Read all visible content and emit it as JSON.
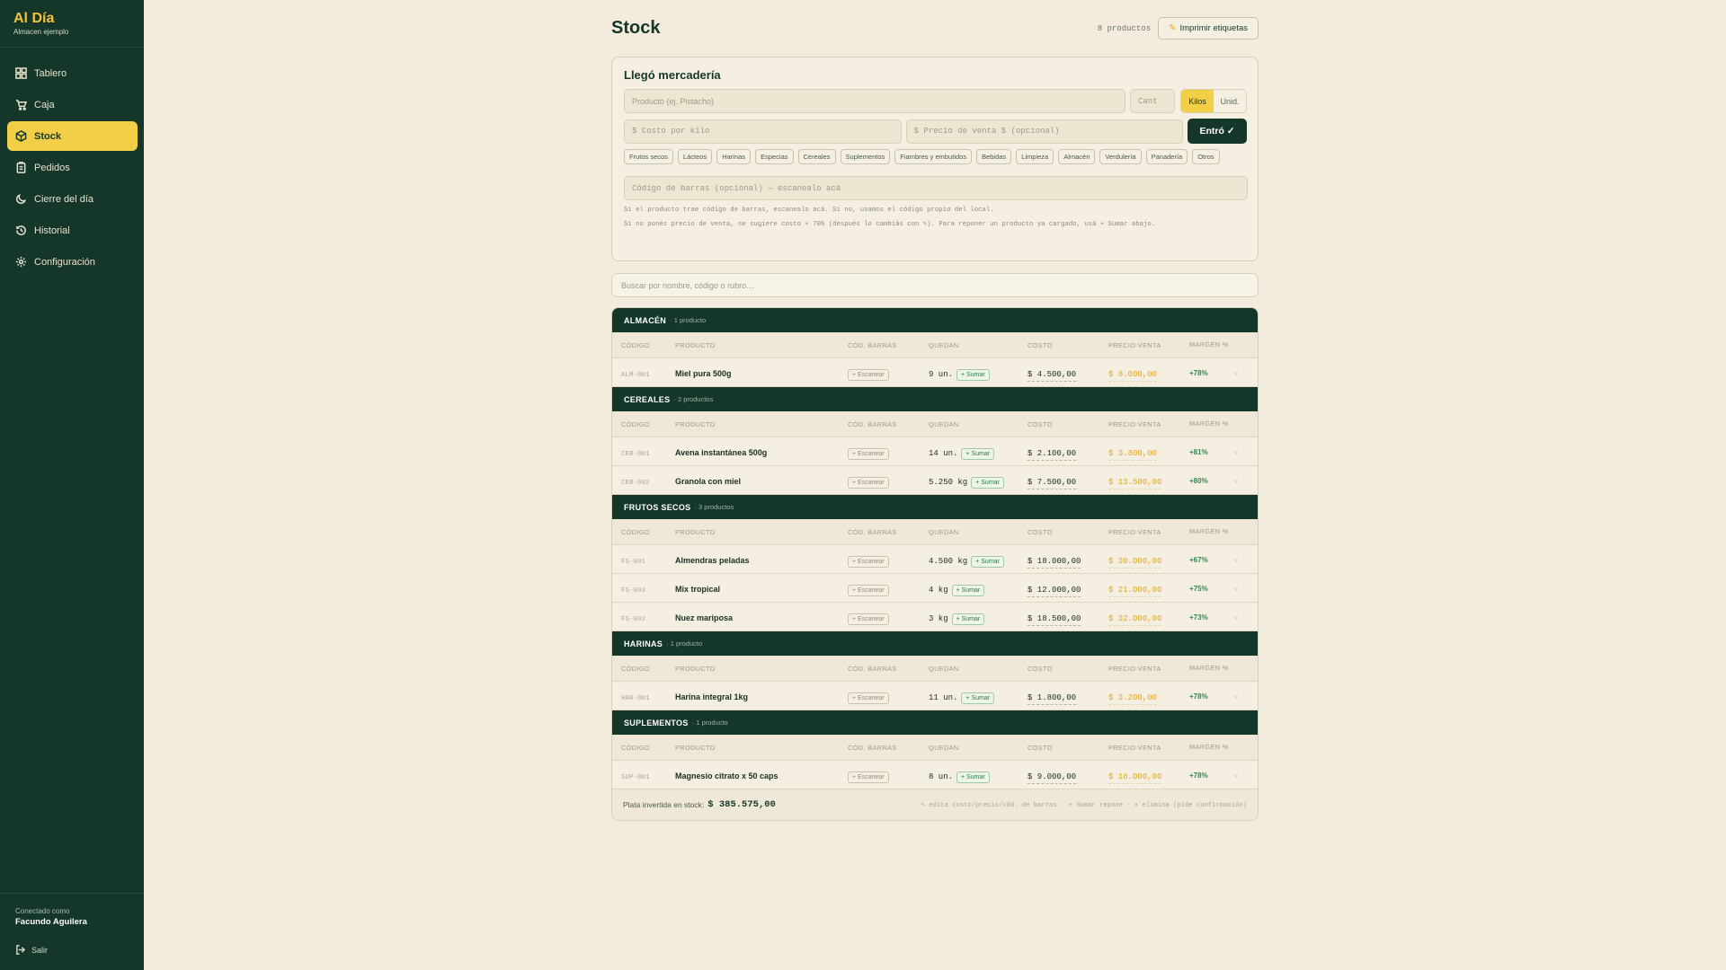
{
  "brand": {
    "name": "Al Día",
    "subtitle": "Almacen ejemplo"
  },
  "nav": [
    {
      "label": "Tablero",
      "icon": "grid-icon",
      "active": false
    },
    {
      "label": "Caja",
      "icon": "cart-icon",
      "active": false
    },
    {
      "label": "Stock",
      "icon": "box-icon",
      "active": true
    },
    {
      "label": "Pedidos",
      "icon": "clipboard-icon",
      "active": false
    },
    {
      "label": "Cierre del día",
      "icon": "moon-icon",
      "active": false
    },
    {
      "label": "Historial",
      "icon": "history-icon",
      "active": false
    },
    {
      "label": "Configuración",
      "icon": "gear-icon",
      "active": false
    }
  ],
  "user": {
    "caption": "Conectado como",
    "name": "Facundo Aguilera",
    "logout": "Salir"
  },
  "colors": {
    "sidebar": "#15372a",
    "accent": "#f3cf48",
    "background": "#f3ecdc",
    "price": "#e2a81b",
    "margin": "#2f8a4e"
  },
  "header": {
    "title": "Stock",
    "count": "8 productos",
    "print_label": "Imprimir etiquetas"
  },
  "form": {
    "title": "Llegó mercadería",
    "product_placeholder": "Producto (ej. Pistacho)",
    "qty_placeholder": "Cant",
    "unit_kilos": "Kilos",
    "unit_units": "Unid.",
    "cost_placeholder": "$ Costo por kilo",
    "price_placeholder": "$ Precio de venta $ (opcional)",
    "submit": "Entró ✓",
    "categories": [
      "Frutos secos",
      "Lácteos",
      "Harinas",
      "Especias",
      "Cereales",
      "Suplementos",
      "Fiambres y embutidos",
      "Bebidas",
      "Limpieza",
      "Almacén",
      "Verdulería",
      "Panadería",
      "Otros"
    ],
    "barcode_placeholder": "Código de barras (opcional) — escanealo acá",
    "help1": "Si el producto trae código de barras, escanealo acá. Si no, usamos el código propio del local.",
    "help2": "Si no ponés precio de venta, se sugiere costo + 70% (después lo cambiás con ✎). Para reponer un producto ya cargado, usá + Sumar abajo."
  },
  "search": {
    "placeholder": "Buscar por nombre, código o rubro…"
  },
  "table": {
    "columns": [
      "CÓDIGO",
      "PRODUCTO",
      "CÓD. BARRAS",
      "QUEDAN",
      "COSTO",
      "PRECIO VENTA",
      "MARGEN %"
    ],
    "scan_label": "+ Escanear",
    "add_label": "+ Sumar",
    "delete_glyph": "×",
    "groups": [
      {
        "name": "ALMACÉN",
        "count": "· 1 producto",
        "rows": [
          {
            "code": "ALM-001",
            "name": "Miel pura 500g",
            "qty": "9 un.",
            "cost": "$ 4.500,00",
            "price": "$ 8.000,00",
            "margin": "+78%"
          }
        ]
      },
      {
        "name": "CEREALES",
        "count": "· 2 productos",
        "rows": [
          {
            "code": "CER-001",
            "name": "Avena instantánea 500g",
            "qty": "14 un.",
            "cost": "$ 2.100,00",
            "price": "$ 3.800,00",
            "margin": "+81%"
          },
          {
            "code": "CER-002",
            "name": "Granola con miel",
            "qty": "5.250 kg",
            "cost": "$ 7.500,00",
            "price": "$ 13.500,00",
            "margin": "+80%"
          }
        ]
      },
      {
        "name": "FRUTOS SECOS",
        "count": "· 3 productos",
        "rows": [
          {
            "code": "FS-001",
            "name": "Almendras peladas",
            "qty": "4.500 kg",
            "cost": "$ 18.000,00",
            "price": "$ 30.000,00",
            "margin": "+67%"
          },
          {
            "code": "FS-003",
            "name": "Mix tropical",
            "qty": "4 kg",
            "cost": "$ 12.000,00",
            "price": "$ 21.000,00",
            "margin": "+75%"
          },
          {
            "code": "FS-002",
            "name": "Nuez mariposa",
            "qty": "3 kg",
            "cost": "$ 18.500,00",
            "price": "$ 32.000,00",
            "margin": "+73%"
          }
        ]
      },
      {
        "name": "HARINAS",
        "count": "· 1 producto",
        "rows": [
          {
            "code": "HAR-001",
            "name": "Harina integral 1kg",
            "qty": "11 un.",
            "cost": "$ 1.800,00",
            "price": "$ 3.200,00",
            "margin": "+78%"
          }
        ]
      },
      {
        "name": "SUPLEMENTOS",
        "count": "· 1 producto",
        "rows": [
          {
            "code": "SUP-001",
            "name": "Magnesio citrato x 50 caps",
            "qty": "8 un.",
            "cost": "$ 9.000,00",
            "price": "$ 16.000,00",
            "margin": "+78%"
          }
        ]
      }
    ],
    "footer_label": "Plata invertida en stock:",
    "footer_total": "$ 385.575,00",
    "footer_hint": "✎ edita costo/precio/cód. de barras · + Sumar repone · × elimina (pide confirmación)"
  }
}
